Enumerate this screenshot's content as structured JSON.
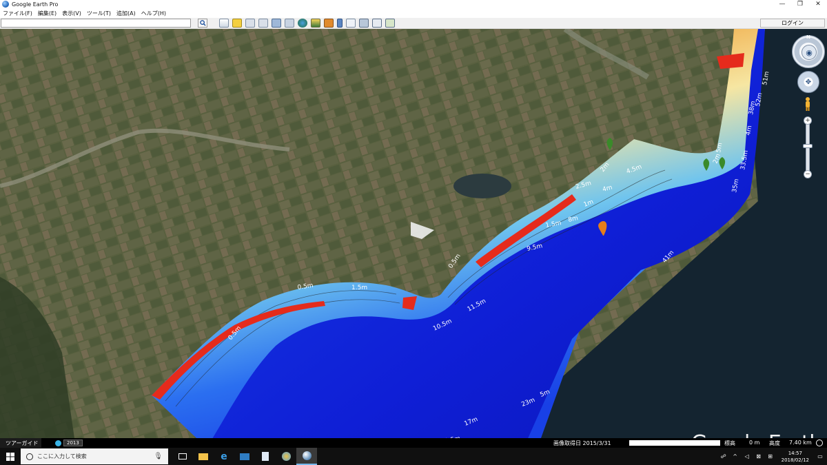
{
  "window": {
    "title": "Google Earth Pro",
    "minimize": "—",
    "maximize": "❐",
    "close": "✕"
  },
  "menu": [
    "ファイル(F)",
    "編集(E)",
    "表示(V)",
    "ツール(T)",
    "追加(A)",
    "ヘルプ(H)"
  ],
  "toolbar": {
    "search_value": "",
    "login_label": "ログイン",
    "tool_icons": [
      "sidebar-toggle-icon",
      "placemark-icon",
      "polygon-icon",
      "path-icon",
      "image-overlay-icon",
      "record-tour-icon",
      "historical-imagery-icon",
      "sunlight-icon",
      "switch-planet-icon",
      "ruler-icon",
      "email-icon",
      "print-icon",
      "save-image-icon",
      "view-in-maps-icon"
    ]
  },
  "map": {
    "depth_labels": [
      "0.5m",
      "1.5m",
      "0.5m",
      "10.5m",
      "11.5m",
      "9.5m",
      "1.5m",
      "8m",
      "1m",
      "4m",
      "2.5m",
      "0.5m",
      "2m",
      "4.5m",
      "2m",
      "5m",
      "33.5m",
      "35m",
      "4m",
      "38m",
      "52m",
      "51m",
      "41m",
      "17m",
      "23m",
      "5m",
      "20.5m"
    ],
    "watermark": "Google Earth",
    "compass_letter": "N"
  },
  "status": {
    "tour_guide": "ツアーガイド",
    "year": "2013",
    "imagery_date": "画像取得日  2015/3/31",
    "elevation_label": "標高",
    "elevation_value": "0 m",
    "altitude_label": "高度",
    "altitude_value": "7.40 km"
  },
  "taskbar": {
    "search_placeholder": "ここに入力して検索",
    "time": "14:57",
    "date": "2018/02/12"
  }
}
